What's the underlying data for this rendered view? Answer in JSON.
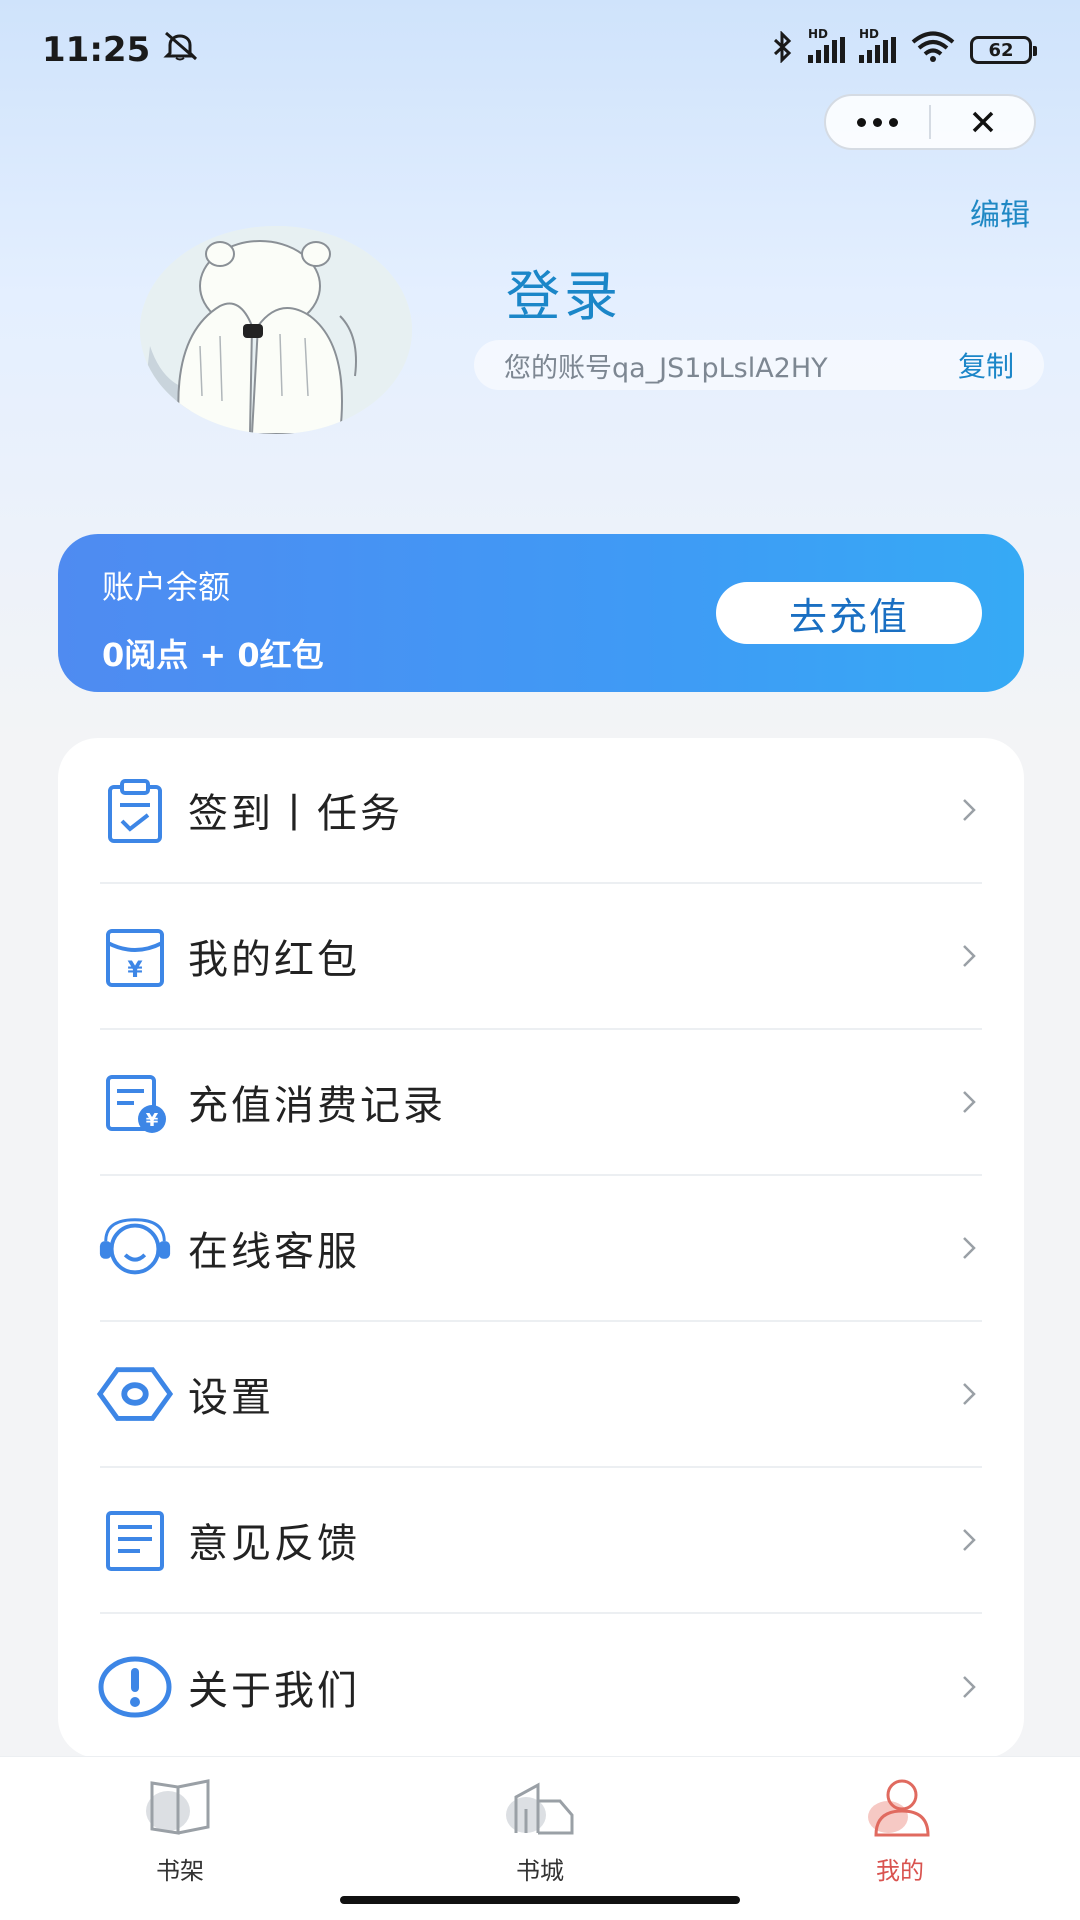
{
  "status_bar": {
    "time": "11:25",
    "battery": "62",
    "hd1": "HD",
    "hd2": "HD"
  },
  "capsule": {
    "more_icon": "more-dots-icon",
    "close_icon": "close-icon"
  },
  "header": {
    "edit_label": "编辑"
  },
  "profile": {
    "login_label": "登录",
    "account_text": "您的账号qa_JS1pLslA2HY",
    "copy_label": "复制"
  },
  "balance": {
    "label": "账户余额",
    "value": "0阅点 + 0红包",
    "recharge_label": "去充值"
  },
  "menu": {
    "items": [
      {
        "label": "签到丨任务",
        "icon": "checklist-icon"
      },
      {
        "label": "我的红包",
        "icon": "red-envelope-icon"
      },
      {
        "label": "充值消费记录",
        "icon": "recharge-record-icon"
      },
      {
        "label": "在线客服",
        "icon": "headset-icon"
      },
      {
        "label": "设置",
        "icon": "settings-icon"
      },
      {
        "label": "意见反馈",
        "icon": "feedback-icon"
      },
      {
        "label": "关于我们",
        "icon": "info-icon"
      }
    ]
  },
  "tabs": [
    {
      "label": "书架",
      "icon": "bookshelf-icon",
      "active": false
    },
    {
      "label": "书城",
      "icon": "bookstore-icon",
      "active": false
    },
    {
      "label": "我的",
      "icon": "profile-icon",
      "active": true
    }
  ],
  "colors": {
    "accent": "#1b86c8",
    "card_gradient_start": "#4f8bf1",
    "card_gradient_end": "#36aaf5",
    "active_tab": "#d9534f"
  }
}
